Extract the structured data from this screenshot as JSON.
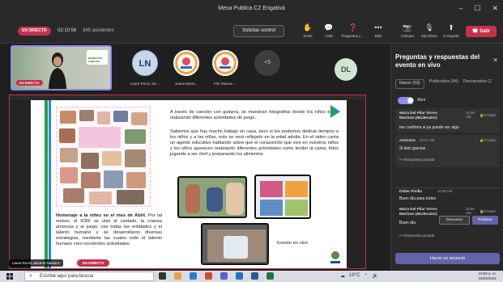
{
  "window": {
    "title": "Mesa Publica CZ Engativá",
    "minimize": "–",
    "maximize": "☐",
    "close": "✕"
  },
  "toolbar": {
    "live_badge": "EN DIRECTO",
    "timer": "02:10:56",
    "attendees": "345 asistentes",
    "request_control": "Solicitar control",
    "buttons": [
      {
        "icon": "hand-icon",
        "glyph": "✋",
        "label": "Sonis"
      },
      {
        "icon": "chat-icon",
        "glyph": "💬",
        "label": "Chat"
      },
      {
        "icon": "qa-icon",
        "glyph": "❓",
        "label": "Preguntas y ..."
      },
      {
        "icon": "more-icon",
        "glyph": "•••",
        "label": "Más"
      },
      {
        "icon": "camera-icon",
        "glyph": "📷",
        "label": "Cámara"
      },
      {
        "icon": "mic-icon",
        "glyph": "🎙",
        "label": "Micrófono"
      },
      {
        "icon": "share-icon",
        "glyph": "⬆",
        "label": "Compartir"
      }
    ],
    "leave": "Salir",
    "accent": "#c4314b"
  },
  "participants": {
    "self_live": "EN DIRECTO",
    "self_logo": "BIENESTAR FAMILIAR",
    "tiles": [
      {
        "initials": "LN",
        "name": "Laura Rocio Jac...",
        "bg": "#c7d6ec",
        "fg": "#233a5e"
      },
      {
        "initials": "",
        "name": "Juana Maria...",
        "bg": "#f4a33c",
        "fg": "#fff"
      },
      {
        "initials": "",
        "name": "Flor Marina ...",
        "bg": "#f4a33c",
        "fg": "#fff"
      }
    ],
    "overflow": "+5",
    "extra_initials": "DL"
  },
  "document": {
    "para1": "A través de canción con guitarra, se muestran fotografías donde los niños están realizando diferentes actividades de juego.",
    "para2": "Sabemos que hay mucho trabajo en casa, pero si los podemos dedicar tiempos a los niños y a las niñas, esto se verá reflejado en la edad adulta. En el video canta un agente educativo hablando sobre que el corazoncito que vive en nuestros niños y los niños aparecen realizando diferentes actividades como tender la cama, fotos jugando a ser chef y preparando los alimentos",
    "para3_bold": "Homenaje a la niñez en el mes de Abril.",
    "para3": "Por tal motivo, el ICBF se unió al cuidado, la crianza amorosa y al juego, con todas las entidades y el talento humano y se desarrollaron diversas estrategias, mediante las cuales todo el talento humano creo excelentes actividades.",
    "event_label": "Evento en vivo",
    "presenter": "Laura Rocio Jacome Navarro",
    "presenter_live": "EN DIRECTO"
  },
  "qa": {
    "title": "Preguntas y respuestas del evento en vivo",
    "tabs": [
      "Nuevo (53)",
      "Publicados (94)",
      "Descartados (2"
    ],
    "toggle_label": "Abrir",
    "items": [
      {
        "author": "Maria Del Pilar Torres Martinez (Moderador)",
        "time": "10:38 AM",
        "private": "Privado",
        "text": "me confirma si ya puede ver algo"
      },
      {
        "author": "Anónimo",
        "time": "10:47 AM",
        "private": "Privado",
        "text": "Si listo gracias",
        "reply": "Respuesta privada"
      },
      {
        "author": "Didier Pinilla",
        "time": "10:55 AM",
        "text": "Buen día para todos"
      },
      {
        "author": "Maria Del Pilar Torres Martinez (Moderador)",
        "time": "10:56 AM",
        "private": "Privado",
        "text": "Buen día",
        "reply": "Respuesta privada"
      }
    ],
    "discard": "Descartar",
    "publish": "Publicar",
    "announce": "Hacer un anuncio"
  },
  "taskbar": {
    "search_placeholder": "Escribe aquí para buscar",
    "weather": "19°C",
    "time": "10:59 a. m.",
    "date": "22/04/2021"
  }
}
